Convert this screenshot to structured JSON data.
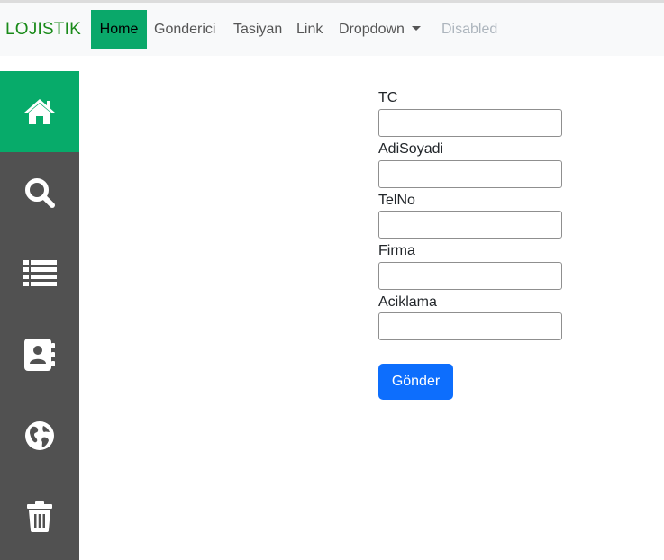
{
  "navbar": {
    "brand": "LOJISTIK",
    "items": [
      {
        "label": "Home",
        "active": true
      },
      {
        "label": "Gonderici"
      },
      {
        "label": "Tasiyan"
      },
      {
        "label": "Link"
      },
      {
        "label": "Dropdown",
        "dropdown": true
      },
      {
        "label": "Disabled",
        "disabled": true
      }
    ]
  },
  "sidebar": {
    "items": [
      {
        "icon": "home-icon",
        "active": true
      },
      {
        "icon": "search-icon"
      },
      {
        "icon": "list-icon"
      },
      {
        "icon": "address-book-icon"
      },
      {
        "icon": "globe-icon"
      },
      {
        "icon": "trash-icon"
      }
    ]
  },
  "form": {
    "fields": [
      {
        "label": "TC",
        "value": ""
      },
      {
        "label": "AdiSoyadi",
        "value": ""
      },
      {
        "label": "TelNo",
        "value": ""
      },
      {
        "label": "Firma",
        "value": ""
      },
      {
        "label": "Aciklama",
        "value": ""
      }
    ],
    "submit_label": "Gönder"
  },
  "colors": {
    "brand": "#198a19",
    "active_green": "#07ab6a",
    "sidebar_bg": "#515151",
    "navbar_bg": "#f8f9fa",
    "primary_button": "#0d6efd"
  }
}
